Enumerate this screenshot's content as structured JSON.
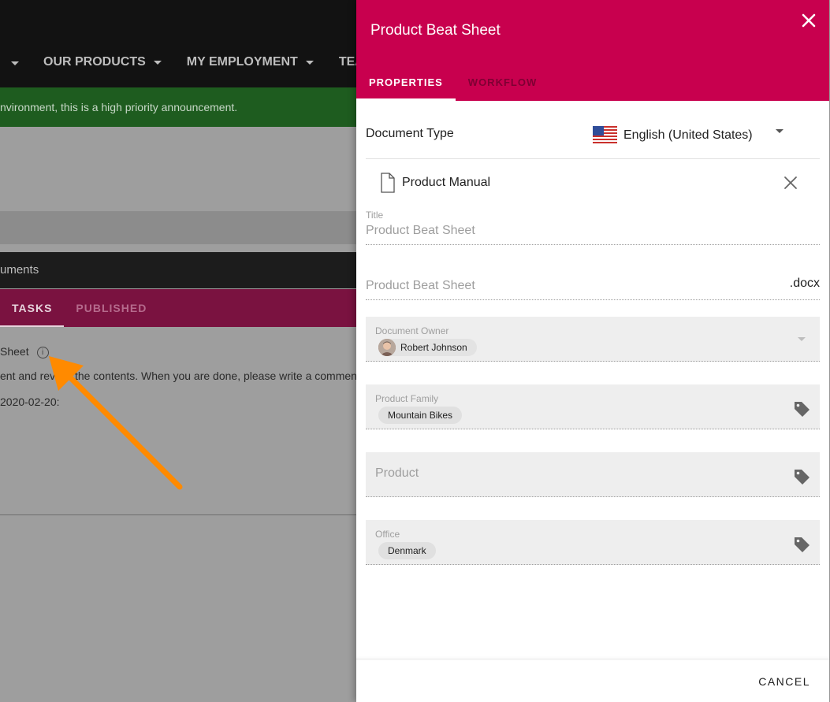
{
  "background": {
    "nav": [
      "OUR PRODUCTS",
      "MY EMPLOYMENT",
      "TEAM"
    ],
    "announcement": "nvironment, this is a high priority announcement.",
    "documents_header": "uments",
    "tabs": [
      "TASKS",
      "PUBLISHED"
    ],
    "task_title": "Sheet",
    "task_text": "ent and review the contents. When you are done, please write a comment",
    "task_date": "2020-02-20:"
  },
  "panel": {
    "title": "Product Beat Sheet",
    "tabs": [
      "PROPERTIES",
      "WORKFLOW"
    ],
    "document_type_label": "Document Type",
    "language": "English (United States)",
    "template": "Product Manual",
    "title_label": "Title",
    "title_value": "Product Beat Sheet",
    "filename_value": "Product Beat Sheet",
    "file_ext": ".docx",
    "owner_label": "Document Owner",
    "owner_value": "Robert Johnson",
    "product_family_label": "Product Family",
    "product_family_value": "Mountain Bikes",
    "product_placeholder": "Product",
    "office_label": "Office",
    "office_value": "Denmark",
    "cancel_label": "CANCEL"
  },
  "colors": {
    "accent": "#c8004e",
    "announcement_green": "#1e5c1f",
    "arrow": "#ff8a00"
  }
}
